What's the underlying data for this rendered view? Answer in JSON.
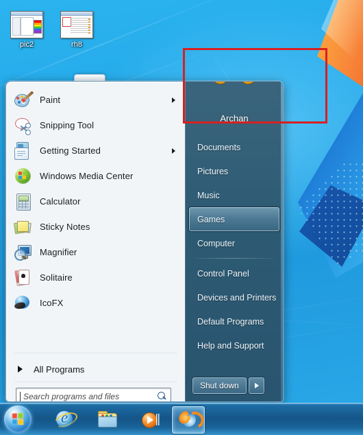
{
  "desktop": {
    "icons": [
      {
        "label": "pic2",
        "icon": "paint-window-thumbnail"
      },
      {
        "label": "rh8",
        "icon": "resource-editor-window-thumbnail"
      }
    ]
  },
  "start_menu": {
    "programs": [
      {
        "label": "Paint",
        "icon": "paint-icon",
        "has_submenu": true
      },
      {
        "label": "Snipping Tool",
        "icon": "snipping-tool-icon",
        "has_submenu": false
      },
      {
        "label": "Getting Started",
        "icon": "getting-started-icon",
        "has_submenu": true
      },
      {
        "label": "Windows Media Center",
        "icon": "windows-media-center-icon",
        "has_submenu": false
      },
      {
        "label": "Calculator",
        "icon": "calculator-icon",
        "has_submenu": false
      },
      {
        "label": "Sticky Notes",
        "icon": "sticky-notes-icon",
        "has_submenu": false
      },
      {
        "label": "Magnifier",
        "icon": "magnifier-icon",
        "has_submenu": false
      },
      {
        "label": "Solitaire",
        "icon": "solitaire-icon",
        "has_submenu": false
      },
      {
        "label": "IcoFX",
        "icon": "icofx-icon",
        "has_submenu": false
      }
    ],
    "all_programs": {
      "label": "All Programs",
      "icon": "right-triangle-icon"
    },
    "search": {
      "placeholder": "Search programs and files",
      "value": "",
      "icon": "search-icon"
    },
    "user": {
      "name": "Archan",
      "picture_icon": "gamepad-user-picture"
    },
    "places": [
      {
        "label": "Documents",
        "selected": false,
        "divider_after": false
      },
      {
        "label": "Pictures",
        "selected": false,
        "divider_after": false
      },
      {
        "label": "Music",
        "selected": false,
        "divider_after": false
      },
      {
        "label": "Games",
        "selected": true,
        "divider_after": false
      },
      {
        "label": "Computer",
        "selected": false,
        "divider_after": true
      },
      {
        "label": "Control Panel",
        "selected": false,
        "divider_after": false
      },
      {
        "label": "Devices and Printers",
        "selected": false,
        "divider_after": false
      },
      {
        "label": "Default Programs",
        "selected": false,
        "divider_after": false
      },
      {
        "label": "Help and Support",
        "selected": false,
        "divider_after": false
      }
    ],
    "shutdown": {
      "label": "Shut down",
      "options_icon": "right-triangle-icon"
    }
  },
  "taskbar": {
    "start_orb": {
      "name": "Start",
      "icon": "windows-orb-icon"
    },
    "buttons": [
      {
        "icon": "internet-explorer-icon",
        "active": false
      },
      {
        "icon": "windows-explorer-icon",
        "active": false
      },
      {
        "icon": "windows-media-player-icon",
        "active": false
      },
      {
        "icon": "firefox-icon",
        "active": true
      }
    ]
  },
  "annotation": {
    "shape": "rectangle",
    "color": "#d82020"
  }
}
